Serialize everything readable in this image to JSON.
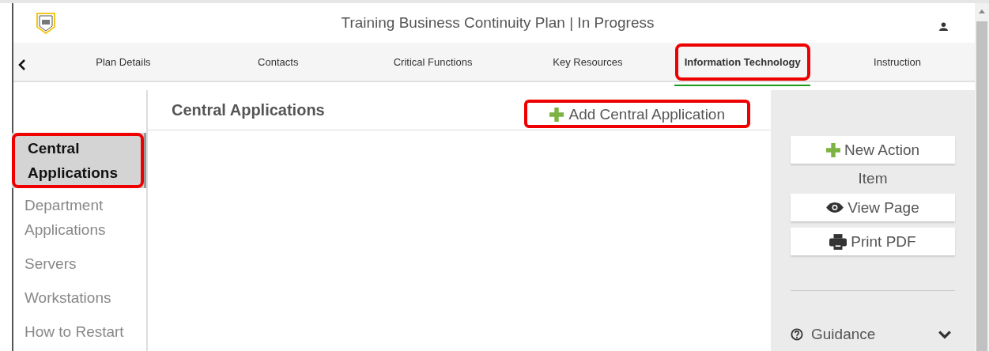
{
  "header": {
    "title": "Training Business Continuity Plan | In Progress"
  },
  "tabs": [
    {
      "label": "Plan Details",
      "selected": false,
      "highlighted": false
    },
    {
      "label": "Contacts",
      "selected": false,
      "highlighted": false
    },
    {
      "label": "Critical Functions",
      "selected": false,
      "highlighted": false
    },
    {
      "label": "Key Resources",
      "selected": false,
      "highlighted": false
    },
    {
      "label": "Information Technology",
      "selected": true,
      "highlighted": true
    },
    {
      "label": "Instruction",
      "selected": false,
      "highlighted": false
    }
  ],
  "sidebar": {
    "items": [
      {
        "label": "Central Applications",
        "selected": true,
        "highlighted": true
      },
      {
        "label": "Department Applications",
        "selected": false,
        "highlighted": false
      },
      {
        "label": "Servers",
        "selected": false,
        "highlighted": false
      },
      {
        "label": "Workstations",
        "selected": false,
        "highlighted": false
      },
      {
        "label": "How to Restart",
        "selected": false,
        "highlighted": false
      }
    ]
  },
  "main": {
    "heading": "Central Applications",
    "add_button": {
      "label": "Add Central Application",
      "highlighted": true
    }
  },
  "actions": {
    "buttons": [
      {
        "kind": "plus",
        "label": "New Action"
      },
      {
        "kind": "text",
        "label": "Item"
      },
      {
        "kind": "eye",
        "label": "View Page"
      },
      {
        "kind": "printer",
        "label": "Print PDF"
      }
    ],
    "guidance": {
      "label": "Guidance",
      "expanded": false
    }
  }
}
